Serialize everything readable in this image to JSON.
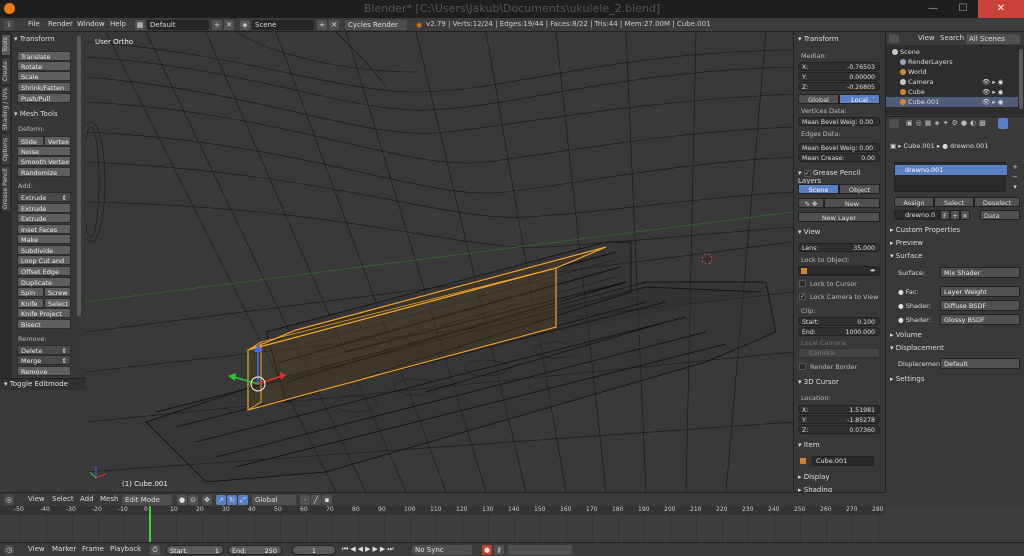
{
  "window": {
    "title": "Blender* [C:\\Users\\Jakub\\Documents\\ukulele_2.blend]",
    "minimize": "—",
    "maximize": "☐",
    "close": "✕"
  },
  "infobar": {
    "menus": [
      "File",
      "Render",
      "Window",
      "Help"
    ],
    "layout": "Default",
    "scene": "Scene",
    "engine": "Cycles Render",
    "stats": "v2.79 | Verts:12/24 | Edges:19/44 | Faces:8/22 | Tris:44 | Mem:27.00M | Cube.001"
  },
  "tabs": [
    "Tools",
    "Create",
    "Shading / UVs",
    "Options",
    "Grease Pencil"
  ],
  "toolshelf": {
    "transform_header": "Transform",
    "transform_buttons": [
      "Translate",
      "Rotate",
      "Scale",
      "Shrink/Fatten",
      "Push/Pull"
    ],
    "meshtools_header": "Mesh Tools",
    "deform_label": "Deform:",
    "slide_edge": "Slide Ed",
    "vertex": "Vertex",
    "noise": "Noise",
    "smooth_vertex": "Smooth Vertex",
    "randomize": "Randomize",
    "add_label": "Add:",
    "extrude": "Extrude",
    "add_buttons": [
      "Extrude Region",
      "Extrude Individual",
      "Inset Faces",
      "Make Edge/Face",
      "Subdivide",
      "Loop Cut and Slide",
      "Offset Edge Slide",
      "Duplicate"
    ],
    "spin": "Spin",
    "screw": "Screw",
    "knife": "Knife",
    "select": "Select",
    "knife_project": "Knife Project",
    "bisect": "Bisect",
    "remove_label": "Remove:",
    "delete": "Delete",
    "merge": "Merge",
    "remove_doubles": "Remove Doubles",
    "toggle_editmode": "Toggle Editmode"
  },
  "viewport": {
    "view_label": "User Ortho",
    "object_label": "(1) Cube.001"
  },
  "view_header": {
    "view": "View",
    "select": "Select",
    "add": "Add",
    "mesh": "Mesh",
    "mode": "Edit Mode",
    "orientation": "Global"
  },
  "props": {
    "transform_header": "Transform",
    "median_label": "Median:",
    "median": [
      {
        "axis": "X:",
        "value": "-0.76503"
      },
      {
        "axis": "Y:",
        "value": "0.00000"
      },
      {
        "axis": "Z:",
        "value": "-0.26805"
      }
    ],
    "global": "Global",
    "local": "Local",
    "vertices_data": "Vertices Data:",
    "mean_bevel_weight": "Mean Bevel Weig: 0.00",
    "edges_data": "Edges Data:",
    "mean_bevel_weight2": "Mean Bevel Weig: 0.00",
    "mean_crease": "Mean Crease:",
    "mean_crease_value": "0.00",
    "grease_header": "Grease Pencil Layers",
    "scene_tab": "Scene",
    "object_tab": "Object",
    "new": "New",
    "new_layer": "New Layer",
    "view_header": "View",
    "lens_label": "Lens:",
    "lens_value": "35.000",
    "lock_to_object": "Lock to Object:",
    "lock_to_cursor": "Lock to Cursor",
    "lock_camera": "Lock Camera to View",
    "clip_label": "Clip:",
    "clip_start_label": "Start:",
    "clip_start": "0.100",
    "clip_end_label": "End:",
    "clip_end": "1000.000",
    "local_camera": "Local Camera:",
    "camera_placeholder": "Camera",
    "render_border": "Render Border",
    "cursor_header": "3D Cursor",
    "location_label": "Location:",
    "cursor": [
      {
        "axis": "X:",
        "value": "1.51981"
      },
      {
        "axis": "Y:",
        "value": "-1.85278"
      },
      {
        "axis": "Z:",
        "value": "0.07360"
      }
    ],
    "item_header": "Item",
    "item_name": "Cube.001",
    "display_header": "Display",
    "shading_header": "Shading"
  },
  "outliner": {
    "view": "View",
    "search": "Search",
    "filter": "All Scenes",
    "rows": [
      {
        "label": "Scene",
        "color": "#c9c9c9"
      },
      {
        "label": "RenderLayers",
        "color": "#9aa3b8"
      },
      {
        "label": "World",
        "color": "#cc8a3a"
      },
      {
        "label": "Camera",
        "color": "#c7c7c7"
      },
      {
        "label": "Cube",
        "color": "#d7822f"
      },
      {
        "label": "Cube.001",
        "color": "#d7822f"
      }
    ]
  },
  "material": {
    "breadcrumb_obj": "Cube.001",
    "breadcrumb_mat": "drewno.001",
    "slot": "drewno.001",
    "assign": "Assign",
    "select": "Select",
    "deselect": "Deselect",
    "mat_name": "drewno.0",
    "fake": "F",
    "data": "Data",
    "custom_props": "Custom Properties",
    "preview": "Preview",
    "surface": "Surface",
    "surface_label": "Surface:",
    "surface_value": "Mix Shader",
    "fac_label": "Fac:",
    "fac_value": "Layer Weight",
    "shader1_label": "Shader:",
    "shader1_value": "Diffuse BSDF",
    "shader2_label": "Shader:",
    "shader2_value": "Glossy BSDF",
    "volume": "Volume",
    "displacement": "Displacement",
    "displacement_label": "Displacement:",
    "displacement_value": "Default",
    "settings": "Settings"
  },
  "timeline": {
    "ticks": [
      "-50",
      "-40",
      "-30",
      "-20",
      "-10",
      "0",
      "10",
      "20",
      "30",
      "40",
      "50",
      "60",
      "70",
      "80",
      "90",
      "100",
      "110",
      "120",
      "130",
      "140",
      "150",
      "160",
      "170",
      "180",
      "190",
      "200",
      "210",
      "220",
      "230",
      "240",
      "250",
      "260",
      "270",
      "280"
    ],
    "current_frame": 0
  },
  "bottombar": {
    "view": "View",
    "marker": "Marker",
    "frame": "Frame",
    "playback": "Playback",
    "start_label": "Start:",
    "start": "1",
    "end_label": "End:",
    "end": "250",
    "current": "1",
    "sync": "No Sync"
  },
  "colors": {
    "selection_orange": "#f0a030",
    "accent_blue": "#5b7fc4",
    "timeline_green": "#3fd13f"
  }
}
